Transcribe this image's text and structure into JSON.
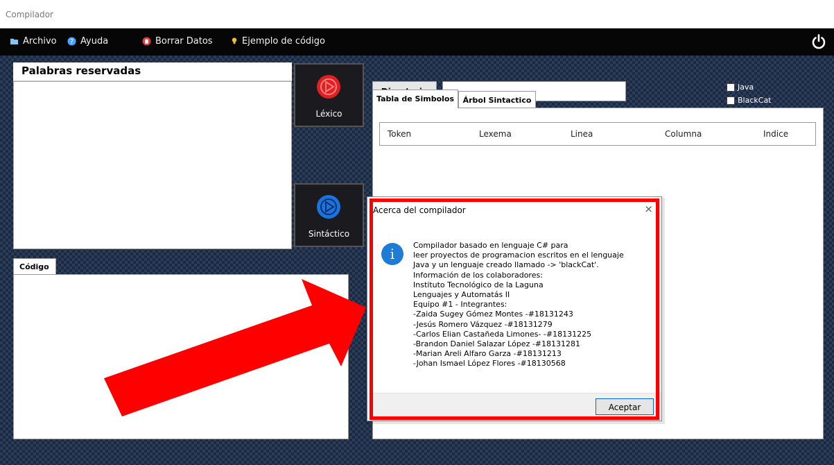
{
  "window": {
    "title": "Compilador"
  },
  "menu": {
    "items": [
      {
        "label": "Archivo",
        "icon": "folder-icon",
        "color": "#7fc6ff"
      },
      {
        "label": "Ayuda",
        "icon": "help-icon",
        "color": "#4aa3ff"
      },
      {
        "label": "Borrar Datos",
        "icon": "trash-icon",
        "color": "#d94040"
      },
      {
        "label": "Ejemplo de código",
        "icon": "bulb-icon",
        "color": "#f3c21a"
      }
    ],
    "power_icon": "power-icon"
  },
  "left": {
    "reserved_title": "Palabras reservadas",
    "codigo_tab": "Código"
  },
  "buttons": {
    "lexico": {
      "label": "Léxico",
      "color": "#e02020"
    },
    "sintactico": {
      "label": "Sintáctico",
      "color": "#1a74e0"
    }
  },
  "right": {
    "directorio_label": "Directorio",
    "directorio_value": "",
    "languages": [
      {
        "label": "Java",
        "checked": false
      },
      {
        "label": "BlackCat",
        "checked": false
      }
    ],
    "tabs": [
      {
        "label": "Tabla de Simbolos",
        "active": true
      },
      {
        "label": "Árbol Sintactico",
        "active": false
      }
    ],
    "columns": [
      "Token",
      "Lexema",
      "Linea",
      "Columna",
      "Indice"
    ]
  },
  "dialog": {
    "title": "Acerca del compilador",
    "close": "×",
    "icon": "info-icon",
    "message": "Compilador basado en lenguaje C# para\n leer proyectos de programacion escritos en el lenguaje\nJava y un lenguaje creado llamado -> 'blackCat'.\nInformación de los colaboradores:\nInstituto Tecnológico de la Laguna\nLenguajes y Automatás II\nEquipo #1 - Integrantes:\n-Zaida Sugey Gómez Montes -#18131243\n-Jesús Romero Vázquez -#18131279\n-Carlos Elian Castañeda Limones- -#18131225\n-Brandon Daniel Salazar López -#18131281\n-Marian Areli Alfaro Garza -#18131213\n-Johan Ismael López Flores -#18130568",
    "ok_label": "Aceptar"
  },
  "annotation": {
    "highlight_color": "#ff0000",
    "arrow_color": "#ff0000"
  }
}
